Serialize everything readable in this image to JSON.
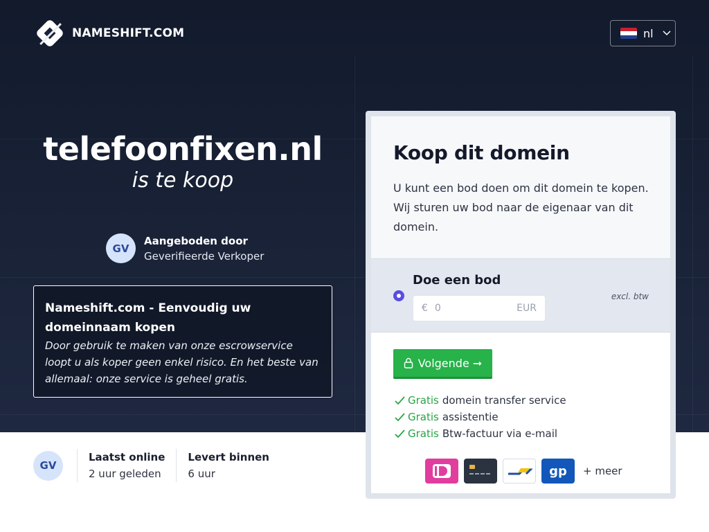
{
  "header": {
    "brand": "NAMESHIFT.COM",
    "language": "nl"
  },
  "hero": {
    "domain": "telefoonfixen.nl",
    "subtitle": "is te koop",
    "seller": {
      "initials": "GV",
      "offered_by_label": "Aangeboden door",
      "seller_name": "Geverifieerde Verkoper"
    },
    "info": {
      "title": "Nameshift.com - Eenvoudig uw domeinnaam kopen",
      "text": "Door gebruik te maken van onze escrowservice loopt u als koper geen enkel risico. En het beste van allemaal: onze service is geheel gratis."
    }
  },
  "stats": {
    "initials": "GV",
    "last_online_label": "Laatst online",
    "last_online_value": "2 uur geleden",
    "delivers_label": "Levert binnen",
    "delivers_value": "6 uur"
  },
  "card": {
    "title": "Koop dit domein",
    "description": "U kunt een bod doen om dit domein te kopen. Wij sturen uw bod naar de eigenaar van dit domein.",
    "bid": {
      "label": "Doe een bod",
      "currency_symbol": "€",
      "placeholder": "0",
      "currency": "EUR",
      "vat_note": "excl. btw"
    },
    "next_button": "Volgende ➞",
    "perks": [
      {
        "highlight": "Gratis",
        "text": "domein transfer service"
      },
      {
        "highlight": "Gratis",
        "text": "assistentie"
      },
      {
        "highlight": "Gratis",
        "text": "Btw-factuur via e-mail"
      }
    ],
    "payments": {
      "methods": [
        "ideal-icon",
        "credit-card-icon",
        "bancontact-icon",
        "giropay-icon"
      ],
      "giropay_text": "gp",
      "more": "+ meer"
    }
  },
  "colors": {
    "hero_bg": "#1a2338",
    "accent_green": "#27b24a",
    "radio": "#5a4de0",
    "avatar_bg": "#d6e4fb"
  }
}
